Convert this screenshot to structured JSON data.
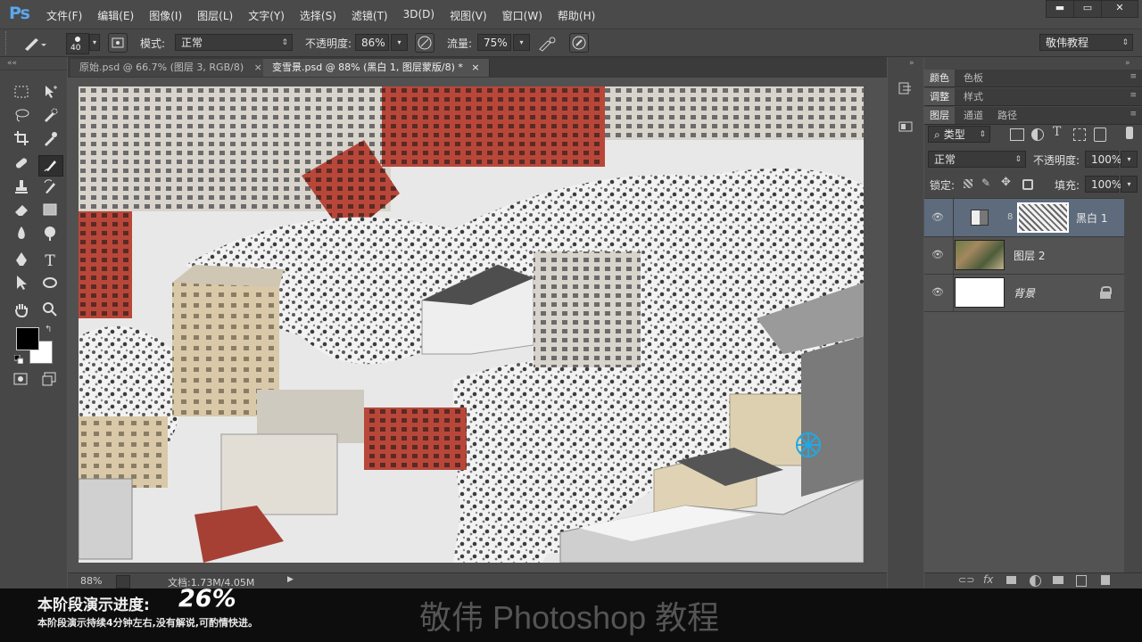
{
  "app": {
    "logo": "Ps"
  },
  "menu": [
    "文件(F)",
    "编辑(E)",
    "图像(I)",
    "图层(L)",
    "文字(Y)",
    "选择(S)",
    "滤镜(T)",
    "3D(D)",
    "视图(V)",
    "窗口(W)",
    "帮助(H)"
  ],
  "window_buttons": {
    "minimize": "▬",
    "maximize": "▭",
    "close": "✕"
  },
  "options": {
    "brush_size": "40",
    "mode_label": "模式:",
    "mode_value": "正常",
    "opacity_label": "不透明度:",
    "opacity_value": "86%",
    "flow_label": "流量:",
    "flow_value": "75%",
    "workspace": "敬伟教程"
  },
  "tabs": [
    {
      "label": "原始.psd @ 66.7% (图层 3, RGB/8)",
      "close": "×"
    },
    {
      "label": "变雪景.psd @ 88% (黑白 1, 图层蒙版/8) *",
      "close": "×"
    }
  ],
  "status": {
    "zoom": "88%",
    "doc": "文档:1.73M/4.05M"
  },
  "panels": {
    "row1": [
      "颜色",
      "色板"
    ],
    "row2": [
      "调整",
      "样式"
    ],
    "row3": [
      "图层",
      "通道",
      "路径"
    ],
    "filter_label": "类型",
    "blend_mode": "正常",
    "opacity_label": "不透明度:",
    "opacity_value": "100%",
    "lock_label": "锁定:",
    "fill_label": "填充:",
    "fill_value": "100%",
    "layers": [
      {
        "name": "黑白 1"
      },
      {
        "name": "图层 2"
      },
      {
        "name": "背景"
      }
    ]
  },
  "overlay": {
    "progress_label": "本阶段演示进度:",
    "progress_value": "26%",
    "note": "本阶段演示持续4分钟左右,没有解说,可酌情快进。",
    "brand": "敬伟 Photoshop 教程"
  },
  "colors": {
    "accent": "#5aa8ee",
    "selected_layer": "#5d6b7c"
  }
}
